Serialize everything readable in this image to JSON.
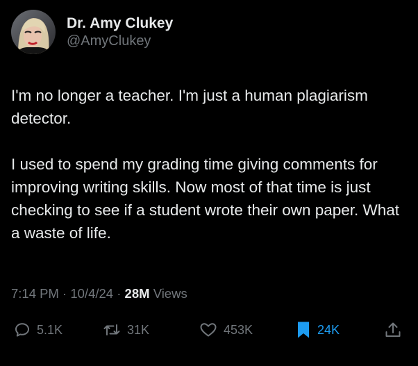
{
  "author": {
    "display_name": "Dr. Amy Clukey",
    "handle": "@AmyClukey"
  },
  "tweet": {
    "paragraphs": [
      "I'm no longer a teacher. I'm just a human plagiarism detector.",
      "I used to spend my grading time giving comments for improving writing skills. Now most of that time is just checking to see if a student wrote their own paper. What a waste of life."
    ],
    "time": "7:14 PM",
    "separator": "·",
    "date": "10/4/24",
    "views_count": "28M",
    "views_label": "Views"
  },
  "actions": {
    "replies": "5.1K",
    "reposts": "31K",
    "likes": "453K",
    "bookmarks": "24K"
  },
  "icons": {
    "reply": "speech-bubble-icon",
    "repost": "repost-arrows-icon",
    "like": "heart-icon",
    "bookmark": "bookmark-icon",
    "share": "share-upload-icon"
  },
  "colors": {
    "background": "#000000",
    "text_primary": "#e7e9ea",
    "text_secondary": "#71767b",
    "accent": "#1d9bf0"
  }
}
